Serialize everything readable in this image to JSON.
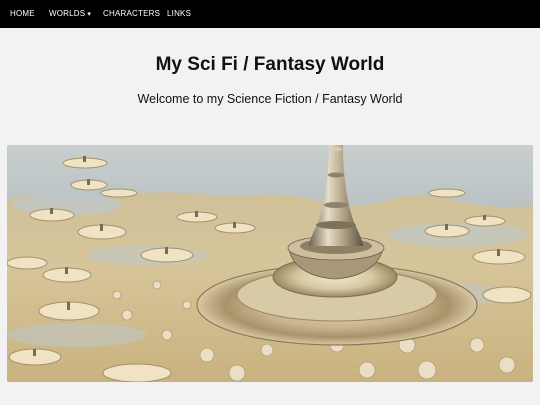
{
  "nav": {
    "items": [
      {
        "label": "HOME"
      },
      {
        "label": "WORLDS",
        "caret": "▾"
      },
      {
        "label": "CHARACTERS"
      },
      {
        "label": "LINKS"
      }
    ]
  },
  "header": {
    "title": "My Sci Fi / Fantasy World",
    "subtitle": "Welcome to my Science Fiction / Fantasy World"
  },
  "hero": {
    "image_subject": "fractal-fantasy-tower-landscape",
    "colors": {
      "sky": "#b9c4cc",
      "ground": "#d9c79a",
      "tower": "#b6a98a"
    }
  }
}
